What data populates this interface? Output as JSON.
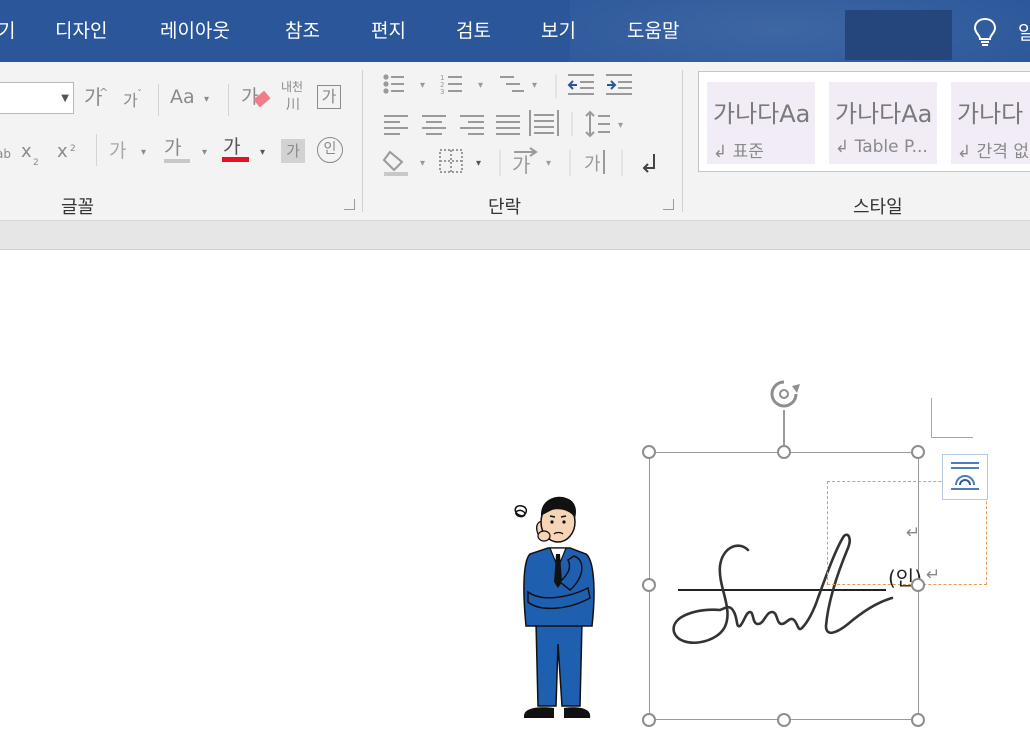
{
  "menu": {
    "tabs": [
      "기",
      "디자인",
      "레이아웃",
      "참조",
      "편지",
      "검토",
      "보기",
      "도움말"
    ],
    "tell_me_partial": "알"
  },
  "ribbon": {
    "font_group": {
      "label": "글꼴",
      "grow_font": "가",
      "shrink_font": "가",
      "change_case": "Aa",
      "clear_format": "가",
      "phonetic_top": "내천",
      "phonetic_bottom": "川",
      "char_border": "가",
      "subscript": "x",
      "subscript_small": "2",
      "superscript": "x",
      "superscript_small": "2",
      "text_effect": "가",
      "highlight": "가",
      "font_color": "가",
      "char_shading": "가",
      "enclosed_char": "인"
    },
    "paragraph_group": {
      "label": "단락"
    },
    "styles_group": {
      "label": "스타일",
      "styles": [
        {
          "sample": "가나다Aa",
          "name": "↲ 표준"
        },
        {
          "sample": "가나다Aa",
          "name": "↲ Table P..."
        },
        {
          "sample": "가나다",
          "name": "↲ 간격 없"
        }
      ]
    }
  },
  "document": {
    "seal_text": "(인)",
    "para_mark": "↵"
  },
  "colors": {
    "menu_blue": "#2b579a",
    "font_color_bar": "#e81123",
    "highlight_bar": "#c8c8c8",
    "frame_orange": "#e69b4f"
  }
}
